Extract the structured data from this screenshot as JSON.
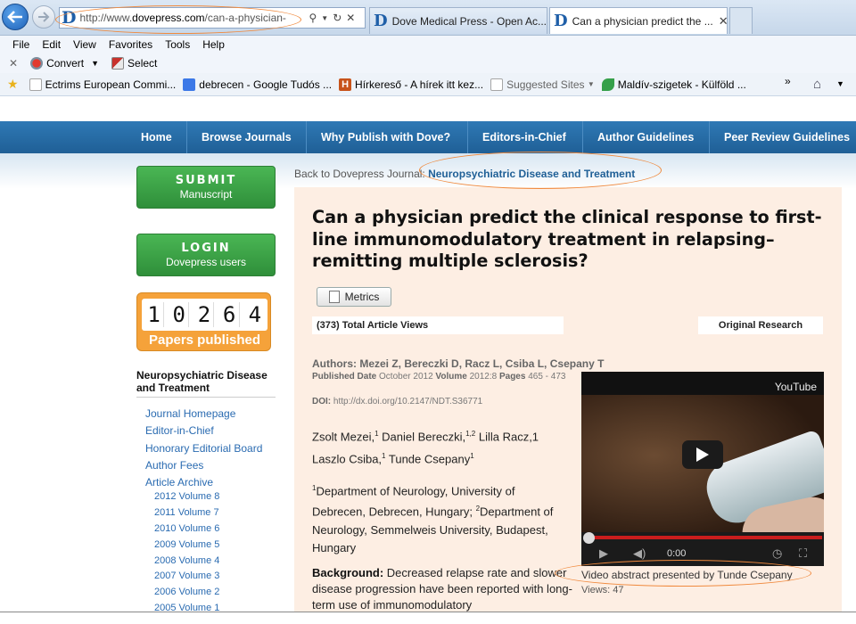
{
  "browser": {
    "address": {
      "domain_prefix": "http://www.",
      "domain": "dovepress.com",
      "path": "/can-a-physician-",
      "controls": [
        "search-icon",
        "dropdown-caret-icon",
        "refresh-icon",
        "stop-icon"
      ]
    },
    "tabs": [
      {
        "label": "Dove Medical Press - Open Ac...",
        "active": false
      },
      {
        "label": "Can a physician predict the ...",
        "active": true,
        "close": "✕"
      }
    ],
    "menu": [
      "File",
      "Edit",
      "View",
      "Favorites",
      "Tools",
      "Help"
    ],
    "command_bar": {
      "close": "✕",
      "convert": "Convert",
      "select": "Select"
    },
    "favorites": [
      {
        "label": "Ectrims  European Commi...",
        "icon": "page-icon"
      },
      {
        "label": "debrecen - Google Tudós ...",
        "icon": "google-icon"
      },
      {
        "label": "Hírkereső - A hírek itt kez...",
        "icon": "h-icon",
        "glyph": "H"
      },
      {
        "label": "Suggested Sites",
        "icon": "page-icon",
        "muted": true
      },
      {
        "label": "Maldív-szigetek - Külföld ...",
        "icon": "leaf-icon"
      }
    ],
    "favorites_more": "»"
  },
  "site_nav": [
    "Home",
    "Browse Journals",
    "Why Publish with Dove?",
    "Editors-in-Chief",
    "Author Guidelines",
    "Peer Review Guidelines"
  ],
  "sidebar": {
    "submit": {
      "line1": "SUBMIT",
      "line2": "Manuscript"
    },
    "login": {
      "line1": "LOGIN",
      "line2": "Dovepress users"
    },
    "counter": {
      "digits": [
        "1",
        "0",
        "2",
        "6",
        "4"
      ],
      "caption": "Papers published"
    },
    "journal_title": "Neuropsychiatric Disease and Treatment",
    "links": [
      "Journal Homepage",
      "Editor-in-Chief",
      "Honorary Editorial Board",
      "Author Fees",
      "Article Archive"
    ],
    "years": [
      "2012 Volume 8",
      "2011 Volume 7",
      "2010 Volume 6",
      "2009 Volume 5",
      "2008 Volume 4",
      "2007 Volume 3",
      "2006 Volume 2",
      "2005 Volume 1"
    ]
  },
  "main": {
    "back_prefix": "Back to Dovepress Journal:",
    "back_journal": "Neuropsychiatric Disease and Treatment",
    "title": "Can a physician predict the clinical response to first-line immunomodulatory treatment in relapsing–remitting multiple sclerosis?",
    "metrics_label": "Metrics",
    "views": "(373) Total Article Views",
    "article_type": "Original Research",
    "authors": "Authors: Mezei Z, Bereczki D, Racz L, Csiba L, Csepany T",
    "pub_label": "Published Date",
    "pub_date": "October 2012",
    "vol_label": "Volume",
    "volume": "2012:8",
    "pages_label": "Pages",
    "pages": "465 - 473",
    "doi_label": "DOI:",
    "doi": "http://dx.doi.org/10.2147/NDT.S36771",
    "author_names_1": "Zsolt Mezei,",
    "author_names_2": "Daniel Bereczki,",
    "author_names_3": "Lilla Racz,1",
    "author_names_4": "Laszlo Csiba,",
    "author_names_5": "Tunde Csepany",
    "sup": {
      "a": "1",
      "b": "1,2",
      "c": "1",
      "d": "1"
    },
    "affil_1_sup": "1",
    "affil_1": "Department of Neurology, University of Debrecen, Debrecen, Hungary;",
    "affil_2_sup": "2",
    "affil_2": "Department of Neurology, Semmelweis University, Budapest, Hungary",
    "background_label": "Background:",
    "background_text": "Decreased relapse rate and slower disease progression have been reported with long-term use of immunomodulatory"
  },
  "video": {
    "brand": "YouTube",
    "time": "0:00",
    "caption": "Video abstract presented by Tunde Csepany",
    "views": "Views: 47"
  },
  "colors": {
    "nav": "#2f79b5",
    "green": "#3ea748",
    "orange": "#f5a23a",
    "panel": "#fdeee3",
    "annotation": "#f08a3e"
  }
}
